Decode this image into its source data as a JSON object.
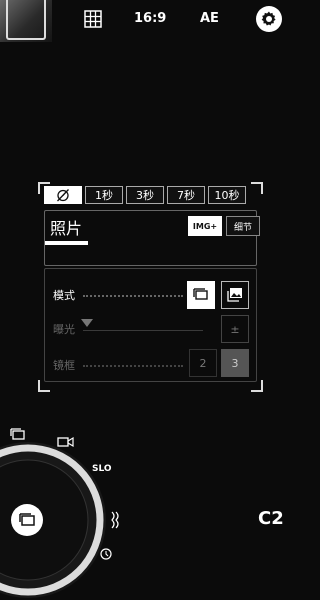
{
  "topbar": {
    "aspect_ratio": "16:9",
    "exposure_mode": "AE",
    "icons": [
      "gallery-thumbnail",
      "grid-icon",
      "gear-icon"
    ]
  },
  "timer": {
    "options": [
      "",
      "1秒",
      "3秒",
      "7秒",
      "10秒"
    ],
    "selected_index": 0,
    "off_icon": "timer-off-icon"
  },
  "capture": {
    "title": "照片",
    "img_plus_label": "IMG+",
    "detail_label": "细节",
    "mode_label": "模式",
    "exposure_label": "曝光",
    "exposure_button": "±",
    "frame_label": "镜框",
    "frame_options": [
      "2",
      "3"
    ],
    "frame_selected": "3"
  },
  "dial": {
    "slo_label": "SLO",
    "modes": [
      "photo-mode-icon",
      "video-icon",
      "slo-mo",
      "hdr-icon",
      "timelapse-icon"
    ]
  },
  "camera_label": "C2",
  "colors": {
    "background": "#0b0b0b",
    "accent": "#ffffff"
  }
}
